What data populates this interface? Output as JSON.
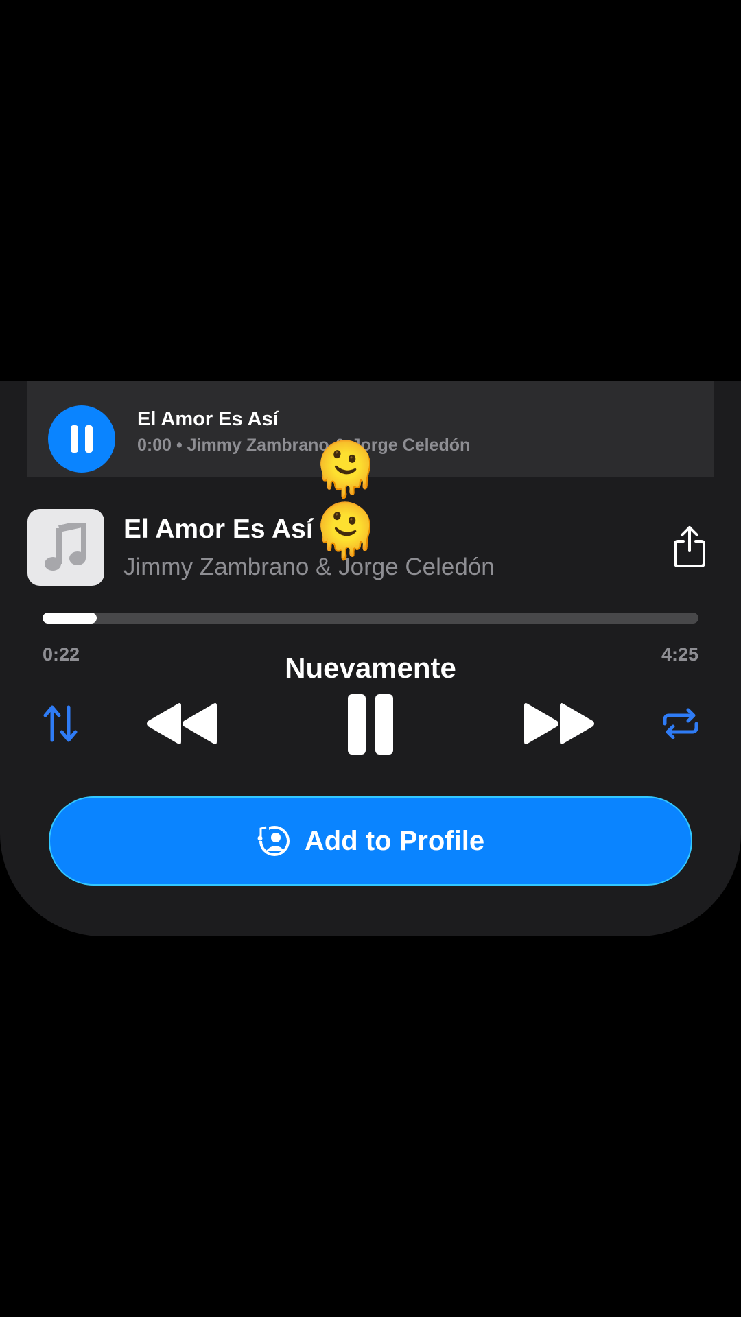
{
  "mini_player": {
    "title": "El Amor Es Así",
    "subtitle": "0:00 • Jimmy Zambrano & Jorge Celedón"
  },
  "overlay": {
    "emoji": "🫠🫠"
  },
  "now_playing": {
    "title": "El Amor Es Así",
    "artist": "Jimmy Zambrano & Jorge Celedón",
    "elapsed": "0:22",
    "duration": "4:25",
    "progress_fraction": 0.083,
    "caption": "Nuevamente"
  },
  "controls": {
    "sort_icon": "sort-arrows-icon",
    "rewind_icon": "rewind-icon",
    "pause_icon": "pause-icon",
    "forward_icon": "fast-forward-icon",
    "repeat_icon": "repeat-icon"
  },
  "action": {
    "label": "Add to Profile",
    "icon": "profile-music-icon"
  },
  "colors": {
    "accent": "#0a84ff",
    "sheet": "#1c1c1e",
    "mini_bg": "#2c2c2e",
    "secondary_text": "#8e8e93"
  }
}
